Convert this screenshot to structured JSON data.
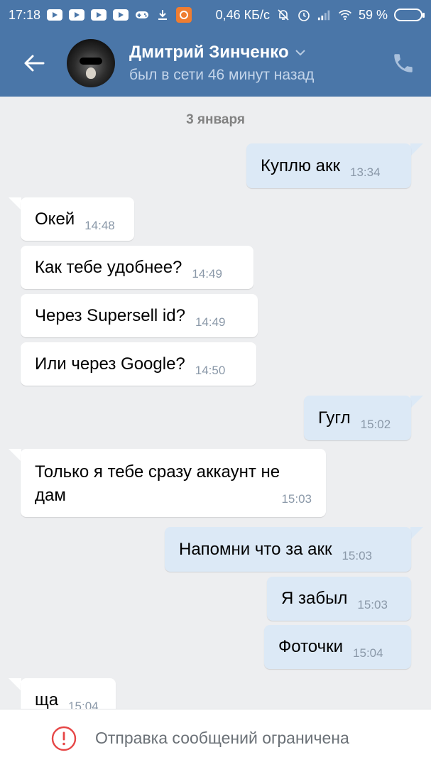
{
  "status_bar": {
    "time": "17:18",
    "speed": "0,46 КБ/с",
    "battery": "59 %"
  },
  "header": {
    "name": "Дмитрий Зинченко",
    "last_seen": "был в сети 46 минут назад"
  },
  "chat": {
    "date_separator": "3 января",
    "messages": [
      {
        "dir": "out",
        "text": "Куплю акк",
        "time": "13:34"
      },
      {
        "dir": "in",
        "text": "Окей",
        "time": "14:48"
      },
      {
        "dir": "in",
        "text": "Как тебе удобнее?",
        "time": "14:49"
      },
      {
        "dir": "in",
        "text": "Через Supersell id?",
        "time": "14:49"
      },
      {
        "dir": "in",
        "text": "Или через Google?",
        "time": "14:50"
      },
      {
        "dir": "out",
        "text": "Гугл",
        "time": "15:02"
      },
      {
        "dir": "in",
        "text_line1": "Только я тебе сразу аккаунт не",
        "text_line2": "дам",
        "time": "15:03"
      },
      {
        "dir": "out",
        "text": "Напомни что за акк",
        "time": "15:03"
      },
      {
        "dir": "out",
        "text": "Я забыл",
        "time": "15:03"
      },
      {
        "dir": "out",
        "text": "Фоточки",
        "time": "15:04"
      },
      {
        "dir": "in",
        "text": "ща",
        "time": "15:04"
      }
    ]
  },
  "footer": {
    "restriction_text": "Отправка сообщений ограничена"
  }
}
